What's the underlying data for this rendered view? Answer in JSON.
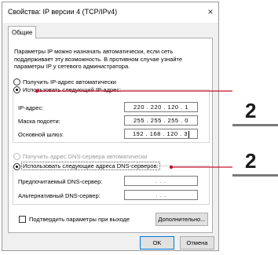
{
  "window": {
    "title": "Свойства: IP версии 4 (TCP/IPv4)",
    "close_symbol": "×"
  },
  "tabs": [
    {
      "label": "Общие"
    }
  ],
  "description": [
    "Параметры IP можно назначать автоматически, если сеть",
    "поддерживает эту возможность. В противном случае узнайте",
    "параметры IP у сетевого администратора."
  ],
  "ip": {
    "auto_label": "Получить IP-адрес автоматически",
    "manual_label": "Использовать следующий IP-адрес:",
    "selected": "manual",
    "fields": [
      {
        "label": "IP-адрес:",
        "value": "220 . 220 . 120 .  1"
      },
      {
        "label": "Маска подсети:",
        "value": "255 . 255 . 255 .  0"
      },
      {
        "label": "Основной шлюз:",
        "value": "192 . 168 . 120 .  3"
      }
    ]
  },
  "dns": {
    "auto_label": "Получить адрес DNS-сервера автоматически",
    "manual_label": "Использовать следующие адреса DNS-серверов:",
    "selected": "manual",
    "fields": [
      {
        "label": "Предпочитаемый DNS-сервер:",
        "value": ".       .       ."
      },
      {
        "label": "Альтернативный DNS-сервер:",
        "value": ".       .       ."
      }
    ]
  },
  "validate_label": "Подтвердить параметры при выходе",
  "advanced_button": "Дополнительно...",
  "ok_button": "OK",
  "cancel_button": "Отмена",
  "callouts": [
    {
      "number": "2"
    },
    {
      "number": "2"
    }
  ],
  "colors": {
    "callout_line": "#c8102e",
    "accent": "#0078d7"
  }
}
